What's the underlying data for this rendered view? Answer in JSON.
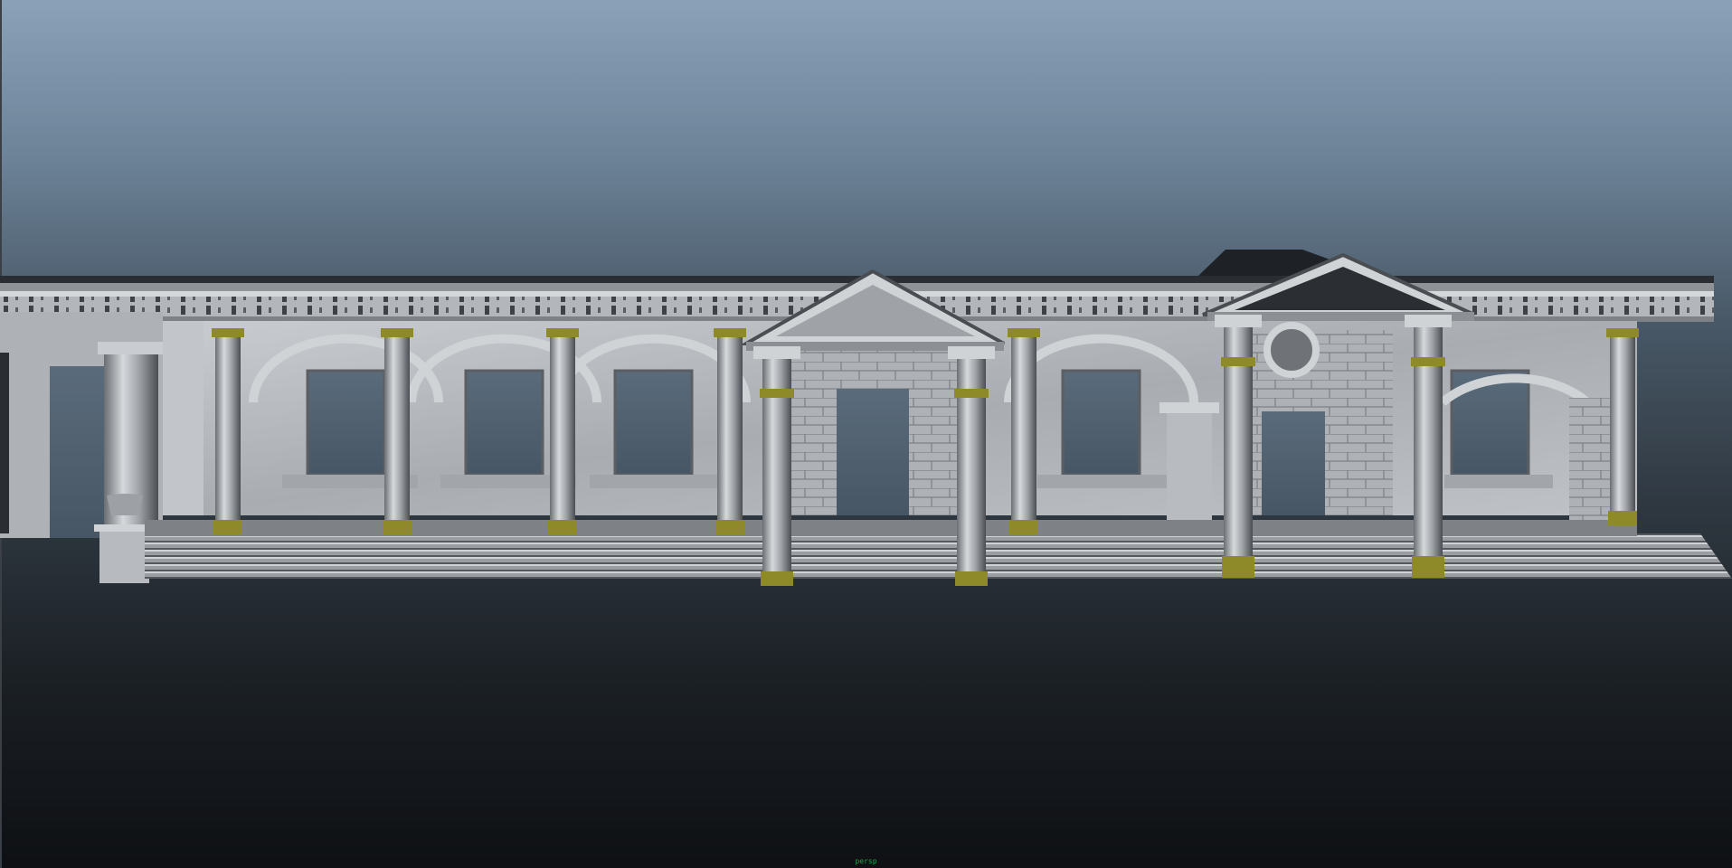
{
  "viewport": {
    "camera_label": "persp"
  },
  "colors": {
    "background_top": "#8aa1b8",
    "background_bottom": "#0e1013",
    "marble": "#b8bcc1",
    "marble_dark": "#6f7378",
    "opening": "#4f5e6b",
    "column_base": "#8e8a2a",
    "camera_label": "#1fa346"
  }
}
